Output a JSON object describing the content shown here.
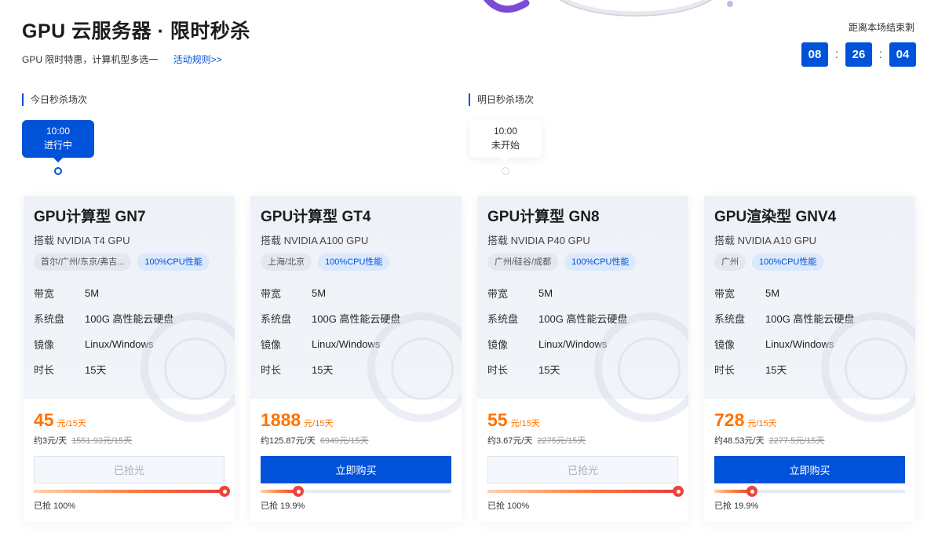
{
  "header": {
    "title": "GPU 云服务器 · 限时秒杀",
    "subtitle": "GPU 限时特惠，计算机型多选一",
    "rules_link": "活动规则>>"
  },
  "countdown": {
    "label": "距离本场结束剩",
    "hours": "08",
    "minutes": "26",
    "seconds": "04",
    "separator": ":"
  },
  "sections": {
    "today": "今日秒杀场次",
    "tomorrow": "明日秒杀场次"
  },
  "sessions": {
    "today": {
      "time": "10:00",
      "status": "进行中"
    },
    "tomorrow": {
      "time": "10:00",
      "status": "未开始"
    }
  },
  "spec_labels": {
    "bandwidth": "带宽",
    "disk": "系统盘",
    "image": "镜像",
    "duration": "时长"
  },
  "cards": [
    {
      "name": "GPU计算型 GN7",
      "gpu": "搭载 NVIDIA T4 GPU",
      "location": "首尔/广州/东京/弗吉...",
      "cpu_tag": "100%CPU性能",
      "bandwidth": "5M",
      "disk": "100G 高性能云硬盘",
      "image": "Linux/Windows",
      "duration": "15天",
      "price": "45",
      "price_unit": "元/15天",
      "daily": "约3元/天",
      "original": "1551.93元/15天",
      "button": "已抢光",
      "sold_out": true,
      "progress": 1.0,
      "grabbed": "已抢 100%"
    },
    {
      "name": "GPU计算型 GT4",
      "gpu": "搭载 NVIDIA A100 GPU",
      "location": "上海/北京",
      "cpu_tag": "100%CPU性能",
      "bandwidth": "5M",
      "disk": "100G 高性能云硬盘",
      "image": "Linux/Windows",
      "duration": "15天",
      "price": "1888",
      "price_unit": "元/15天",
      "daily": "约125.87元/天",
      "original": "6949元/15天",
      "button": "立即购买",
      "sold_out": false,
      "progress": 0.199,
      "grabbed": "已抢 19.9%"
    },
    {
      "name": "GPU计算型 GN8",
      "gpu": "搭载 NVIDIA P40 GPU",
      "location": "广州/硅谷/成都",
      "cpu_tag": "100%CPU性能",
      "bandwidth": "5M",
      "disk": "100G 高性能云硬盘",
      "image": "Linux/Windows",
      "duration": "15天",
      "price": "55",
      "price_unit": "元/15天",
      "daily": "约3.67元/天",
      "original": "2275元/15天",
      "button": "已抢光",
      "sold_out": true,
      "progress": 1.0,
      "grabbed": "已抢 100%"
    },
    {
      "name": "GPU渲染型 GNV4",
      "gpu": "搭载 NVIDIA A10 GPU",
      "location": "广州",
      "cpu_tag": "100%CPU性能",
      "bandwidth": "5M",
      "disk": "100G 高性能云硬盘",
      "image": "Linux/Windows",
      "duration": "15天",
      "price": "728",
      "price_unit": "元/15天",
      "daily": "约48.53元/天",
      "original": "2277.5元/15天",
      "button": "立即购买",
      "sold_out": false,
      "progress": 0.199,
      "grabbed": "已抢 19.9%"
    }
  ],
  "colors": {
    "accent": "#0052d9",
    "price": "#ff7200",
    "progress_end": "#e8453c"
  }
}
